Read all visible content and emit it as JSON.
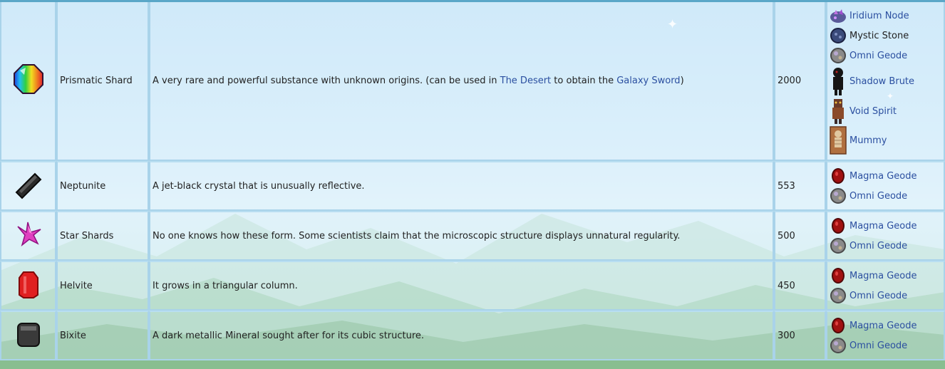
{
  "rows": [
    {
      "name": "Prismatic Shard",
      "description_prefix": "A very rare and powerful substance with unknown origins. (can be used in ",
      "description_link1": "The Desert",
      "description_mid": " to obtain the ",
      "description_link2": "Galaxy Sword",
      "description_suffix": ")",
      "value": "2000",
      "sources": [
        {
          "label": "Iridium Node",
          "icon": "iridium-node-icon",
          "link": true
        },
        {
          "label": "Mystic Stone",
          "icon": "mystic-stone-icon",
          "link": false
        },
        {
          "label": "Omni Geode",
          "icon": "omni-geode-icon",
          "link": true
        },
        {
          "label": "Shadow Brute",
          "icon": "shadow-brute-icon",
          "link": true
        },
        {
          "label": "Void Spirit",
          "icon": "void-spirit-icon",
          "link": true
        },
        {
          "label": "Mummy",
          "icon": "mummy-icon",
          "link": true
        }
      ]
    },
    {
      "name": "Neptunite",
      "description": "A jet-black crystal that is unusually reflective.",
      "value": "553",
      "sources": [
        {
          "label": "Magma Geode",
          "icon": "magma-geode-icon",
          "link": true
        },
        {
          "label": "Omni Geode",
          "icon": "omni-geode-icon",
          "link": true
        }
      ]
    },
    {
      "name": "Star Shards",
      "description": "No one knows how these form. Some scientists claim that the microscopic structure displays unnatural regularity.",
      "value": "500",
      "sources": [
        {
          "label": "Magma Geode",
          "icon": "magma-geode-icon",
          "link": true
        },
        {
          "label": "Omni Geode",
          "icon": "omni-geode-icon",
          "link": true
        }
      ]
    },
    {
      "name": "Helvite",
      "description": "It grows in a triangular column.",
      "value": "450",
      "sources": [
        {
          "label": "Magma Geode",
          "icon": "magma-geode-icon",
          "link": true
        },
        {
          "label": "Omni Geode",
          "icon": "omni-geode-icon",
          "link": true
        }
      ]
    },
    {
      "name": "Bixite",
      "description": "A dark metallic Mineral sought after for its cubic structure.",
      "value": "300",
      "sources": [
        {
          "label": "Magma Geode",
          "icon": "magma-geode-icon",
          "link": true
        },
        {
          "label": "Omni Geode",
          "icon": "omni-geode-icon",
          "link": true
        }
      ]
    }
  ],
  "colors": {
    "link": "#2b4fa0",
    "border": "#a9d3ea",
    "top_bar": "#5aa7c8"
  }
}
